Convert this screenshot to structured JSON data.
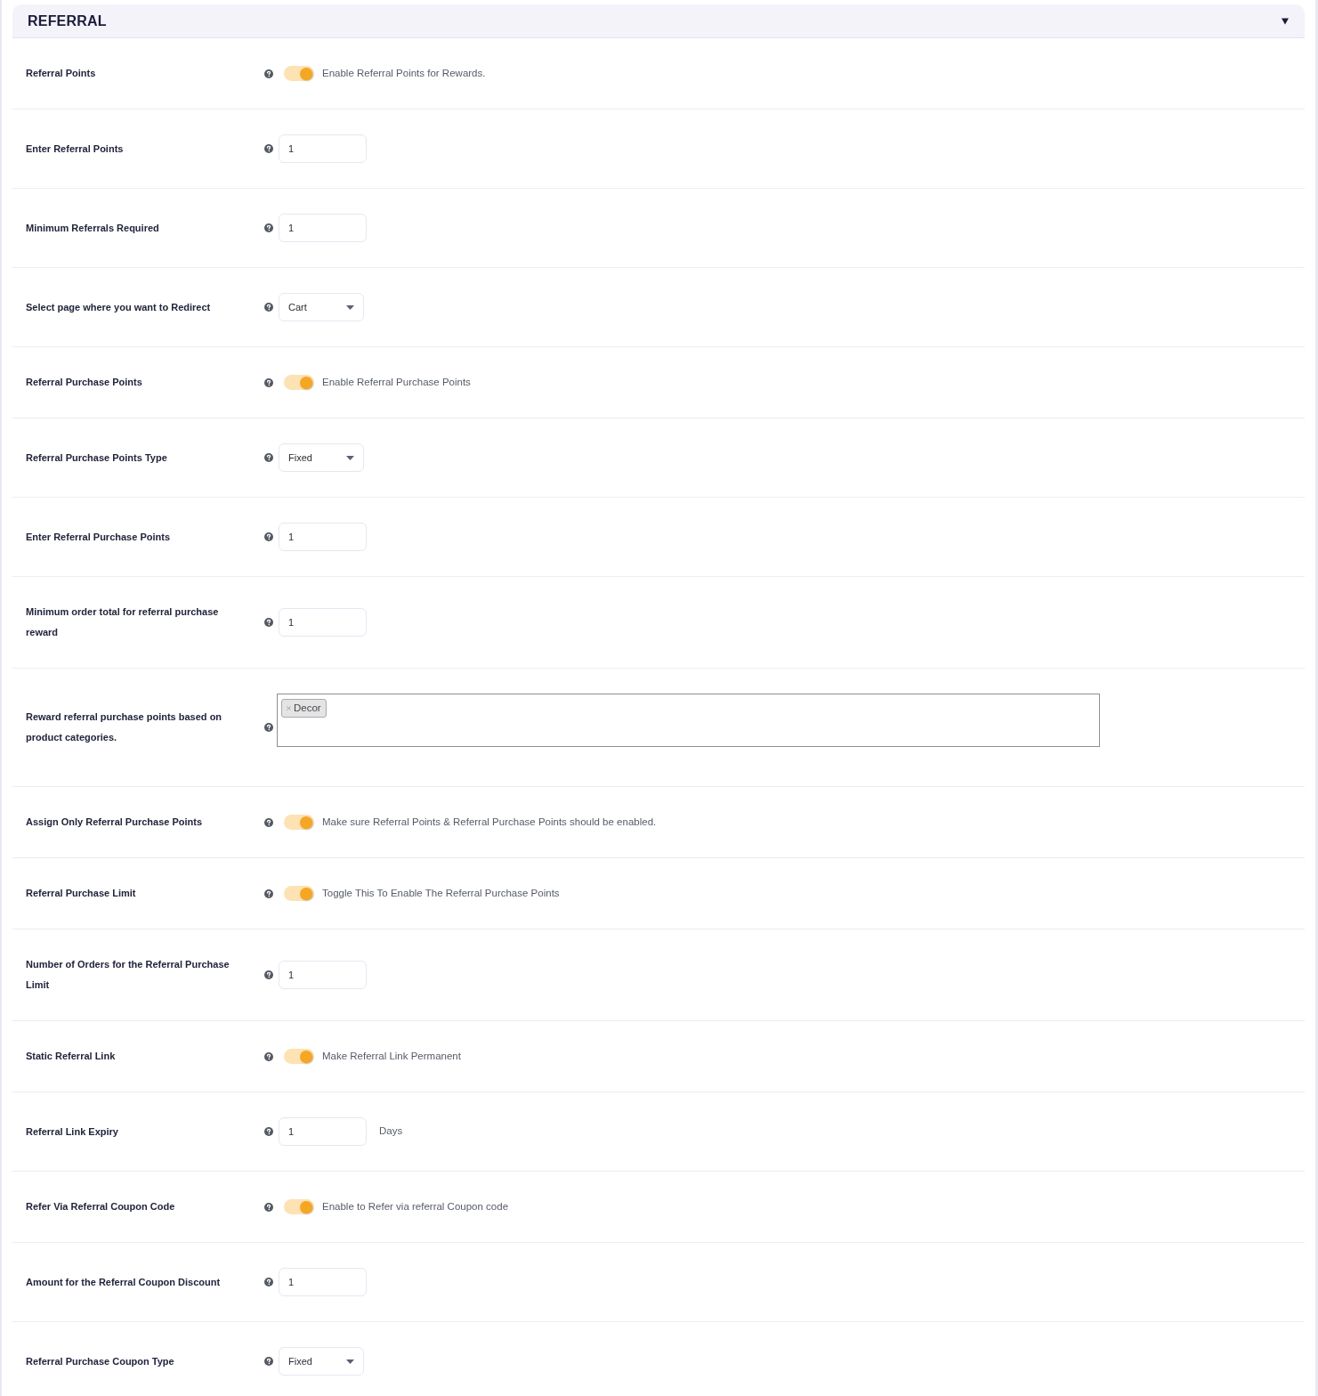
{
  "section": {
    "title": "REFERRAL"
  },
  "settings": [
    {
      "kind": "toggle",
      "label": "Referral Points",
      "on": true,
      "description": "Enable Referral Points for Rewards."
    },
    {
      "kind": "number",
      "label": "Enter Referral Points",
      "value": "1"
    },
    {
      "kind": "number",
      "label": "Minimum Referrals Required",
      "value": "1"
    },
    {
      "kind": "select",
      "label": "Select page where you want to Redirect",
      "value": "Cart"
    },
    {
      "kind": "toggle",
      "label": "Referral Purchase Points",
      "on": true,
      "description": "Enable Referral Purchase Points"
    },
    {
      "kind": "select",
      "label": "Referral Purchase Points Type",
      "value": "Fixed"
    },
    {
      "kind": "number",
      "label": "Enter Referral Purchase Points",
      "value": "1"
    },
    {
      "kind": "number",
      "label": "Minimum order total for referral purchase reward",
      "value": "1"
    },
    {
      "kind": "multiselect",
      "label": "Reward referral purchase points based on product categories.",
      "tags": [
        "Decor"
      ]
    },
    {
      "kind": "toggle",
      "label": "Assign Only Referral Purchase Points",
      "on": true,
      "description": "Make sure Referral Points & Referral Purchase Points should be enabled."
    },
    {
      "kind": "toggle",
      "label": "Referral Purchase Limit",
      "on": true,
      "description": "Toggle This To Enable The Referral Purchase Points"
    },
    {
      "kind": "number",
      "label": "Number of Orders for the Referral Purchase Limit",
      "value": "1"
    },
    {
      "kind": "toggle",
      "label": "Static Referral Link",
      "on": true,
      "description": "Make Referral Link Permanent"
    },
    {
      "kind": "number",
      "label": "Referral Link Expiry",
      "value": "1",
      "suffix": "Days"
    },
    {
      "kind": "toggle",
      "label": "Refer Via Referral Coupon Code",
      "on": true,
      "description": "Enable to Refer via referral Coupon code"
    },
    {
      "kind": "number",
      "label": "Amount for the Referral Coupon Discount",
      "value": "1"
    },
    {
      "kind": "select",
      "label": "Referral Purchase Coupon Type",
      "value": "Fixed"
    }
  ]
}
